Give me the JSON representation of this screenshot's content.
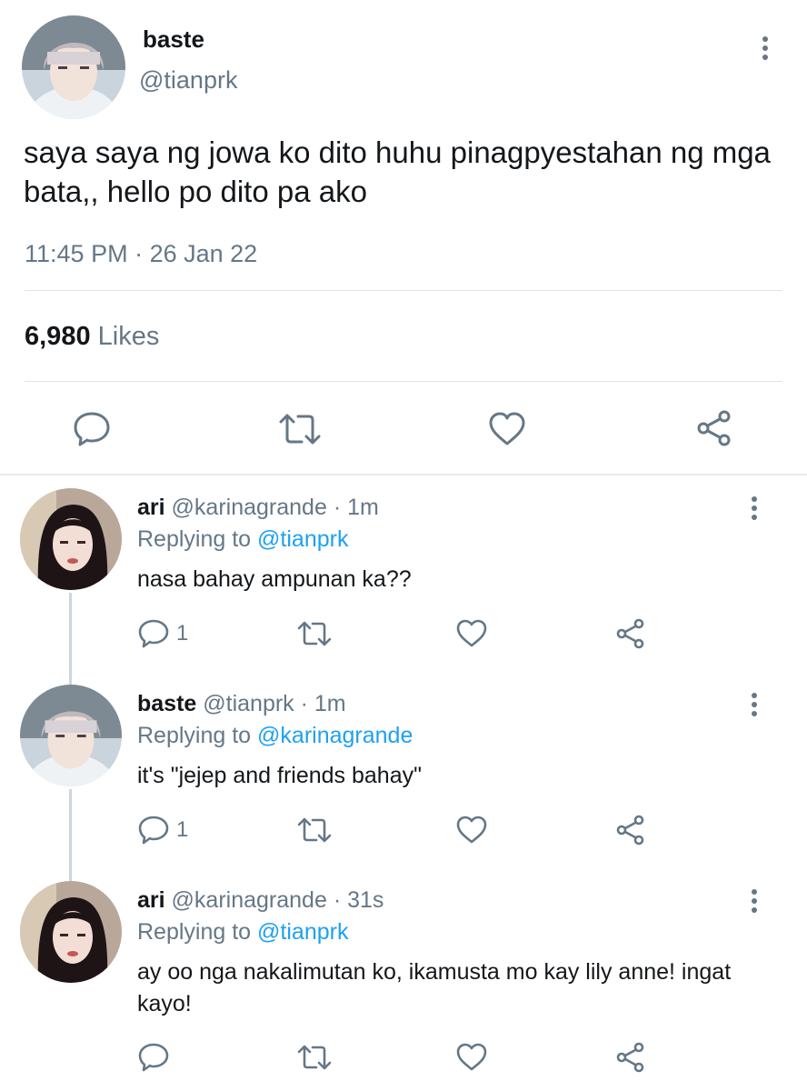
{
  "main": {
    "name": "baste",
    "handle": "@tianprk",
    "text": "saya saya ng jowa ko dito huhu pinagpyestahan ng mga bata,, hello po dito pa ako",
    "time": "11:45 PM",
    "date_sep": " · ",
    "date": "26 Jan 22",
    "likes_count": "6,980",
    "likes_label": "Likes"
  },
  "replies": [
    {
      "name": "ari",
      "handle": "@karinagrande",
      "meta": " · 1m",
      "replying_label": "Replying to",
      "replying_to": "@tianprk",
      "text": "nasa bahay ampunan ka??",
      "reply_count": "1"
    },
    {
      "name": "baste",
      "handle": "@tianprk",
      "meta": " · 1m",
      "replying_label": "Replying to",
      "replying_to": "@karinagrande",
      "text": "it's \"jejep and friends bahay\"",
      "reply_count": "1"
    },
    {
      "name": "ari",
      "handle": "@karinagrande",
      "meta": " · 31s",
      "replying_label": "Replying to",
      "replying_to": "@tianprk",
      "text": "ay oo nga nakalimutan ko, ikamusta mo kay lily anne! ingat kayo!",
      "reply_count": ""
    }
  ],
  "icons": {
    "reply": "reply-icon",
    "retweet": "retweet-icon",
    "like": "heart-icon",
    "share": "share-icon",
    "more": "more-vertical-icon"
  },
  "colors": {
    "text": "#14171a",
    "secondary": "#657786",
    "link": "#1da1f2",
    "divider": "#dfe3e6",
    "thread_line": "#ccd6dd"
  }
}
